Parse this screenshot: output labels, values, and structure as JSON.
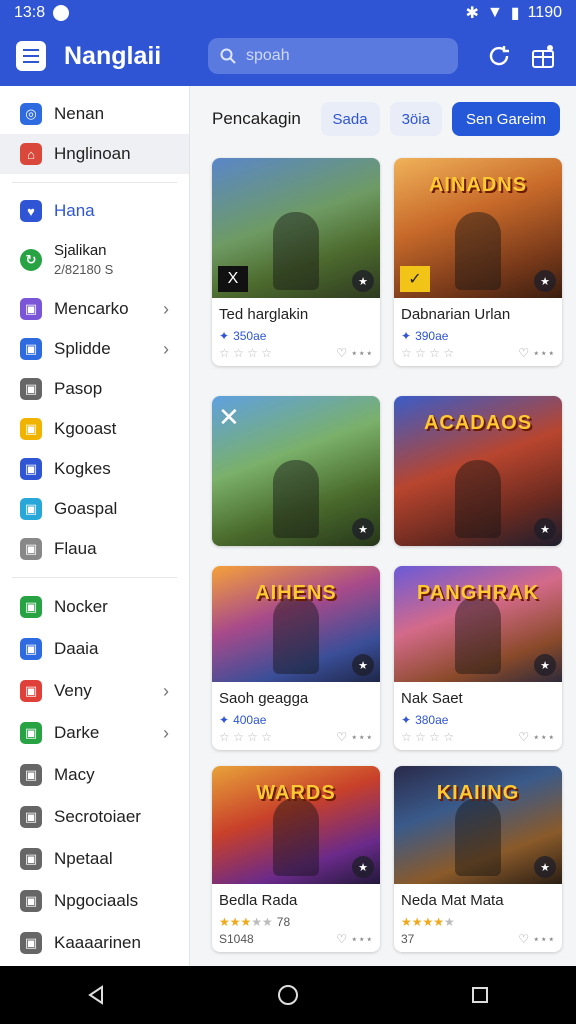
{
  "status": {
    "time": "13:8",
    "right_text": "1190"
  },
  "appbar": {
    "title": "Nanglaii",
    "search_placeholder": "spoah"
  },
  "sidebar": {
    "group1": [
      {
        "label": "Nenan",
        "color": "#2f6be0"
      },
      {
        "label": "Hnglinoan",
        "color": "#d9483b"
      }
    ],
    "group2_first": {
      "label": "Hana",
      "color": "#2f55d4"
    },
    "group2_two": {
      "line1": "Sjalikan",
      "line2": "2/82180 S",
      "color": "#27a344"
    },
    "group2": [
      {
        "label": "Mencarko",
        "color": "#7a55d8",
        "chevron": "›"
      },
      {
        "label": "Splidde",
        "color": "#2f6be0",
        "chevron": "›"
      },
      {
        "label": "Pasop",
        "color": "#666666"
      },
      {
        "label": "Kgooast",
        "color": "#f0b400"
      },
      {
        "label": "Kogkes",
        "color": "#2f55d4"
      },
      {
        "label": "Goaspal",
        "color": "#28a7d8"
      },
      {
        "label": "Flaua",
        "color": "#888888"
      }
    ],
    "group3": [
      {
        "label": "Nocker",
        "color": "#27a344"
      },
      {
        "label": "Daaia",
        "color": "#2f6be0"
      },
      {
        "label": "Veny",
        "color": "#e0403a",
        "chevron": "›"
      },
      {
        "label": "Darke",
        "color": "#27a344",
        "chevron": "›"
      },
      {
        "label": "Macy",
        "color": "#666666"
      },
      {
        "label": "Secrotoiaer",
        "color": "#666666"
      },
      {
        "label": "Npetaal",
        "color": "#666666"
      },
      {
        "label": "Npgociaals",
        "color": "#666666"
      },
      {
        "label": "Kaaaarinen",
        "color": "#666666"
      }
    ]
  },
  "main": {
    "heading": "Pencakagin",
    "chips": [
      "Sada",
      "3öia",
      "Sen Gareim"
    ]
  },
  "cards": [
    {
      "name": "Ted harglakin",
      "price": "350ae",
      "right": "♡ ⋆⋆⋆",
      "art": "",
      "bg": "linear-gradient(160deg,#5a86c9 0%,#6e9b63 45%,#4d6b2e 70%,#2e3a20 100%)",
      "tag": "X",
      "tag_style": "dark",
      "has_info": true,
      "stars": 0
    },
    {
      "name": "Dabnarian Urlan",
      "price": "390ae",
      "right": "♡ ⋆⋆⋆",
      "art": "AINADNS",
      "bg": "linear-gradient(160deg,#f0b25a 0%,#c86a2a 40%,#7a3a1a 75%,#3a1e10 100%)",
      "tag": "✓",
      "tag_style": "yellow",
      "has_info": true,
      "stars": 0
    },
    {
      "name": "",
      "price": "",
      "right": "",
      "art": "",
      "bg": "linear-gradient(160deg,#5fa0e0 0%,#7ab06a 40%,#4a6b2c 70%,#26361a 100%)",
      "tag": "",
      "x_mark": "✕",
      "has_info": false
    },
    {
      "name": "",
      "price": "",
      "right": "",
      "art": "ACADAOS",
      "bg": "linear-gradient(160deg,#3a5cc8 0%,#b8452e 45%,#6a2a20 75%,#1e1e2e 100%)",
      "tag": "",
      "has_info": false
    },
    {
      "name": "Saoh geagga",
      "price": "400ae",
      "right": "♡ ⋆⋆⋆",
      "art": "AIHENS",
      "bg": "linear-gradient(160deg,#f5a13a 0%,#a84a8a 40%,#3a4e98 75%,#1e2648 100%)",
      "tag": "",
      "has_info": true,
      "stars": 0
    },
    {
      "name": "Nak Saet",
      "price": "380ae",
      "right": "♡ ⋆⋆⋆",
      "art": "PANGHRAK",
      "bg": "linear-gradient(160deg,#6a5ad8 0%,#d46a8a 40%,#8a4a2a 75%,#2e2a3a 100%)",
      "tag": "",
      "has_info": true,
      "stars": 0
    },
    {
      "name": "Bedla Rada",
      "price": "S1048",
      "right": "♡ ⋆⋆⋆",
      "art": "WARDS",
      "bg": "linear-gradient(160deg,#e8a23a 0%,#c8402a 40%,#6a2a8a 75%,#22183a 100%)",
      "tag": "",
      "has_info": true,
      "stars": 3,
      "rating_text": "78"
    },
    {
      "name": "Neda Mat Mata",
      "price": "37",
      "right": "♡ ⋆⋆⋆",
      "art": "KIAIING",
      "bg": "linear-gradient(160deg,#2a2a4a 0%,#3a5a8a 35%,#8a5a2a 70%,#2a1e14 100%)",
      "tag": "",
      "has_info": true,
      "stars": 4,
      "rating_text": ""
    }
  ]
}
